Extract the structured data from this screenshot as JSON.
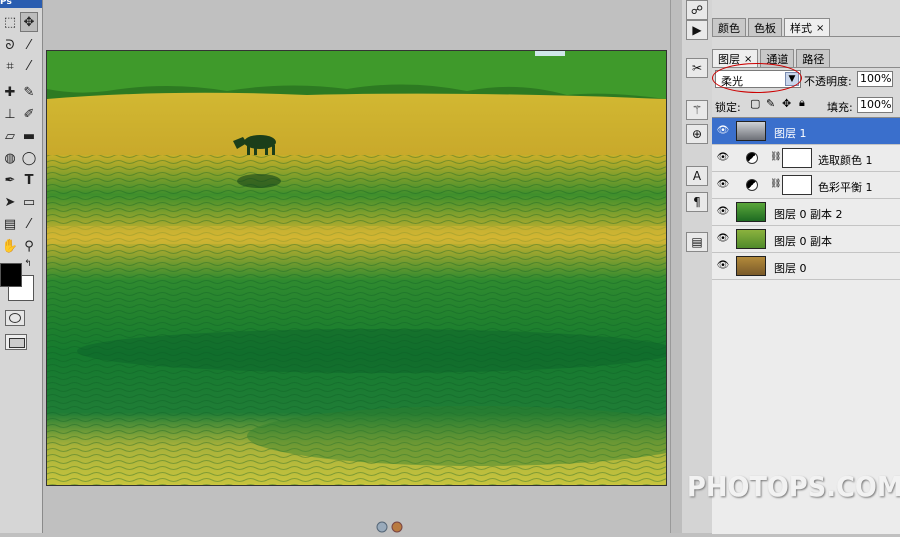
{
  "toolbox": {
    "title": "Ps",
    "tools": [
      {
        "icon": "marquee-tool-icon",
        "glyph": "⬚"
      },
      {
        "icon": "move-tool-icon",
        "glyph": "✥"
      },
      {
        "icon": "lasso-tool-icon",
        "glyph": "ᘐ"
      },
      {
        "icon": "magic-wand-tool-icon",
        "glyph": "⁄"
      },
      {
        "icon": "crop-tool-icon",
        "glyph": "⌗"
      },
      {
        "icon": "slice-tool-icon",
        "glyph": "⁄"
      },
      {
        "icon": "healing-brush-tool-icon",
        "glyph": "✚"
      },
      {
        "icon": "brush-tool-icon",
        "glyph": "✎"
      },
      {
        "icon": "clone-stamp-tool-icon",
        "glyph": "⊥"
      },
      {
        "icon": "history-brush-tool-icon",
        "glyph": "✐"
      },
      {
        "icon": "eraser-tool-icon",
        "glyph": "▱"
      },
      {
        "icon": "gradient-tool-icon",
        "glyph": "▬"
      },
      {
        "icon": "blur-tool-icon",
        "glyph": "◍"
      },
      {
        "icon": "dodge-tool-icon",
        "glyph": "◯"
      },
      {
        "icon": "pen-tool-icon",
        "glyph": "✒"
      },
      {
        "icon": "type-tool-icon",
        "glyph": "T"
      },
      {
        "icon": "path-selection-tool-icon",
        "glyph": "➤"
      },
      {
        "icon": "shape-tool-icon",
        "glyph": "▭"
      },
      {
        "icon": "notes-tool-icon",
        "glyph": "▤"
      },
      {
        "icon": "eyedropper-tool-icon",
        "glyph": "⁄"
      },
      {
        "icon": "hand-tool-icon",
        "glyph": "✋"
      },
      {
        "icon": "zoom-tool-icon",
        "glyph": "⚲"
      }
    ],
    "foreground_color": "#000000",
    "background_color": "#ffffff"
  },
  "panels": {
    "top_tabs": [
      {
        "label": "颜色",
        "active": false
      },
      {
        "label": "色板",
        "active": false
      },
      {
        "label": "样式",
        "active": true,
        "close": "×"
      }
    ],
    "layers_tabs": [
      {
        "label": "图层",
        "active": true,
        "close": "×"
      },
      {
        "label": "通道",
        "active": false
      },
      {
        "label": "路径",
        "active": false
      }
    ],
    "blend_mode": "柔光",
    "opacity_label": "不透明度:",
    "opacity_value": "100%",
    "lock_label": "锁定:",
    "fill_label": "填充:",
    "fill_value": "100%",
    "layers": [
      {
        "name": "图层 1",
        "type": "pixel",
        "selected": true,
        "thumb": "#9aa0a8"
      },
      {
        "name": "选取颜色 1",
        "type": "adjustment",
        "selected": false
      },
      {
        "name": "色彩平衡 1",
        "type": "adjustment",
        "selected": false
      },
      {
        "name": "图层 0 副本 2",
        "type": "pixel",
        "selected": false,
        "thumb": "#3f8a2a"
      },
      {
        "name": "图层 0 副本",
        "type": "pixel",
        "selected": false,
        "thumb": "#7a9a3a"
      },
      {
        "name": "图层 0",
        "type": "pixel",
        "selected": false,
        "thumb": "#a07a3a"
      }
    ]
  },
  "dock_icons": [
    "navigator-icon",
    "actions-icon",
    "tools-preset-icon",
    "brushes-icon",
    "clone-source-icon",
    "character-icon",
    "paragraph-icon",
    "layer-comps-icon"
  ],
  "watermark": "PHOTOPS.COM",
  "colors": {
    "selection_blue": "#3a6fcc",
    "annotation_red": "#cc0000"
  }
}
